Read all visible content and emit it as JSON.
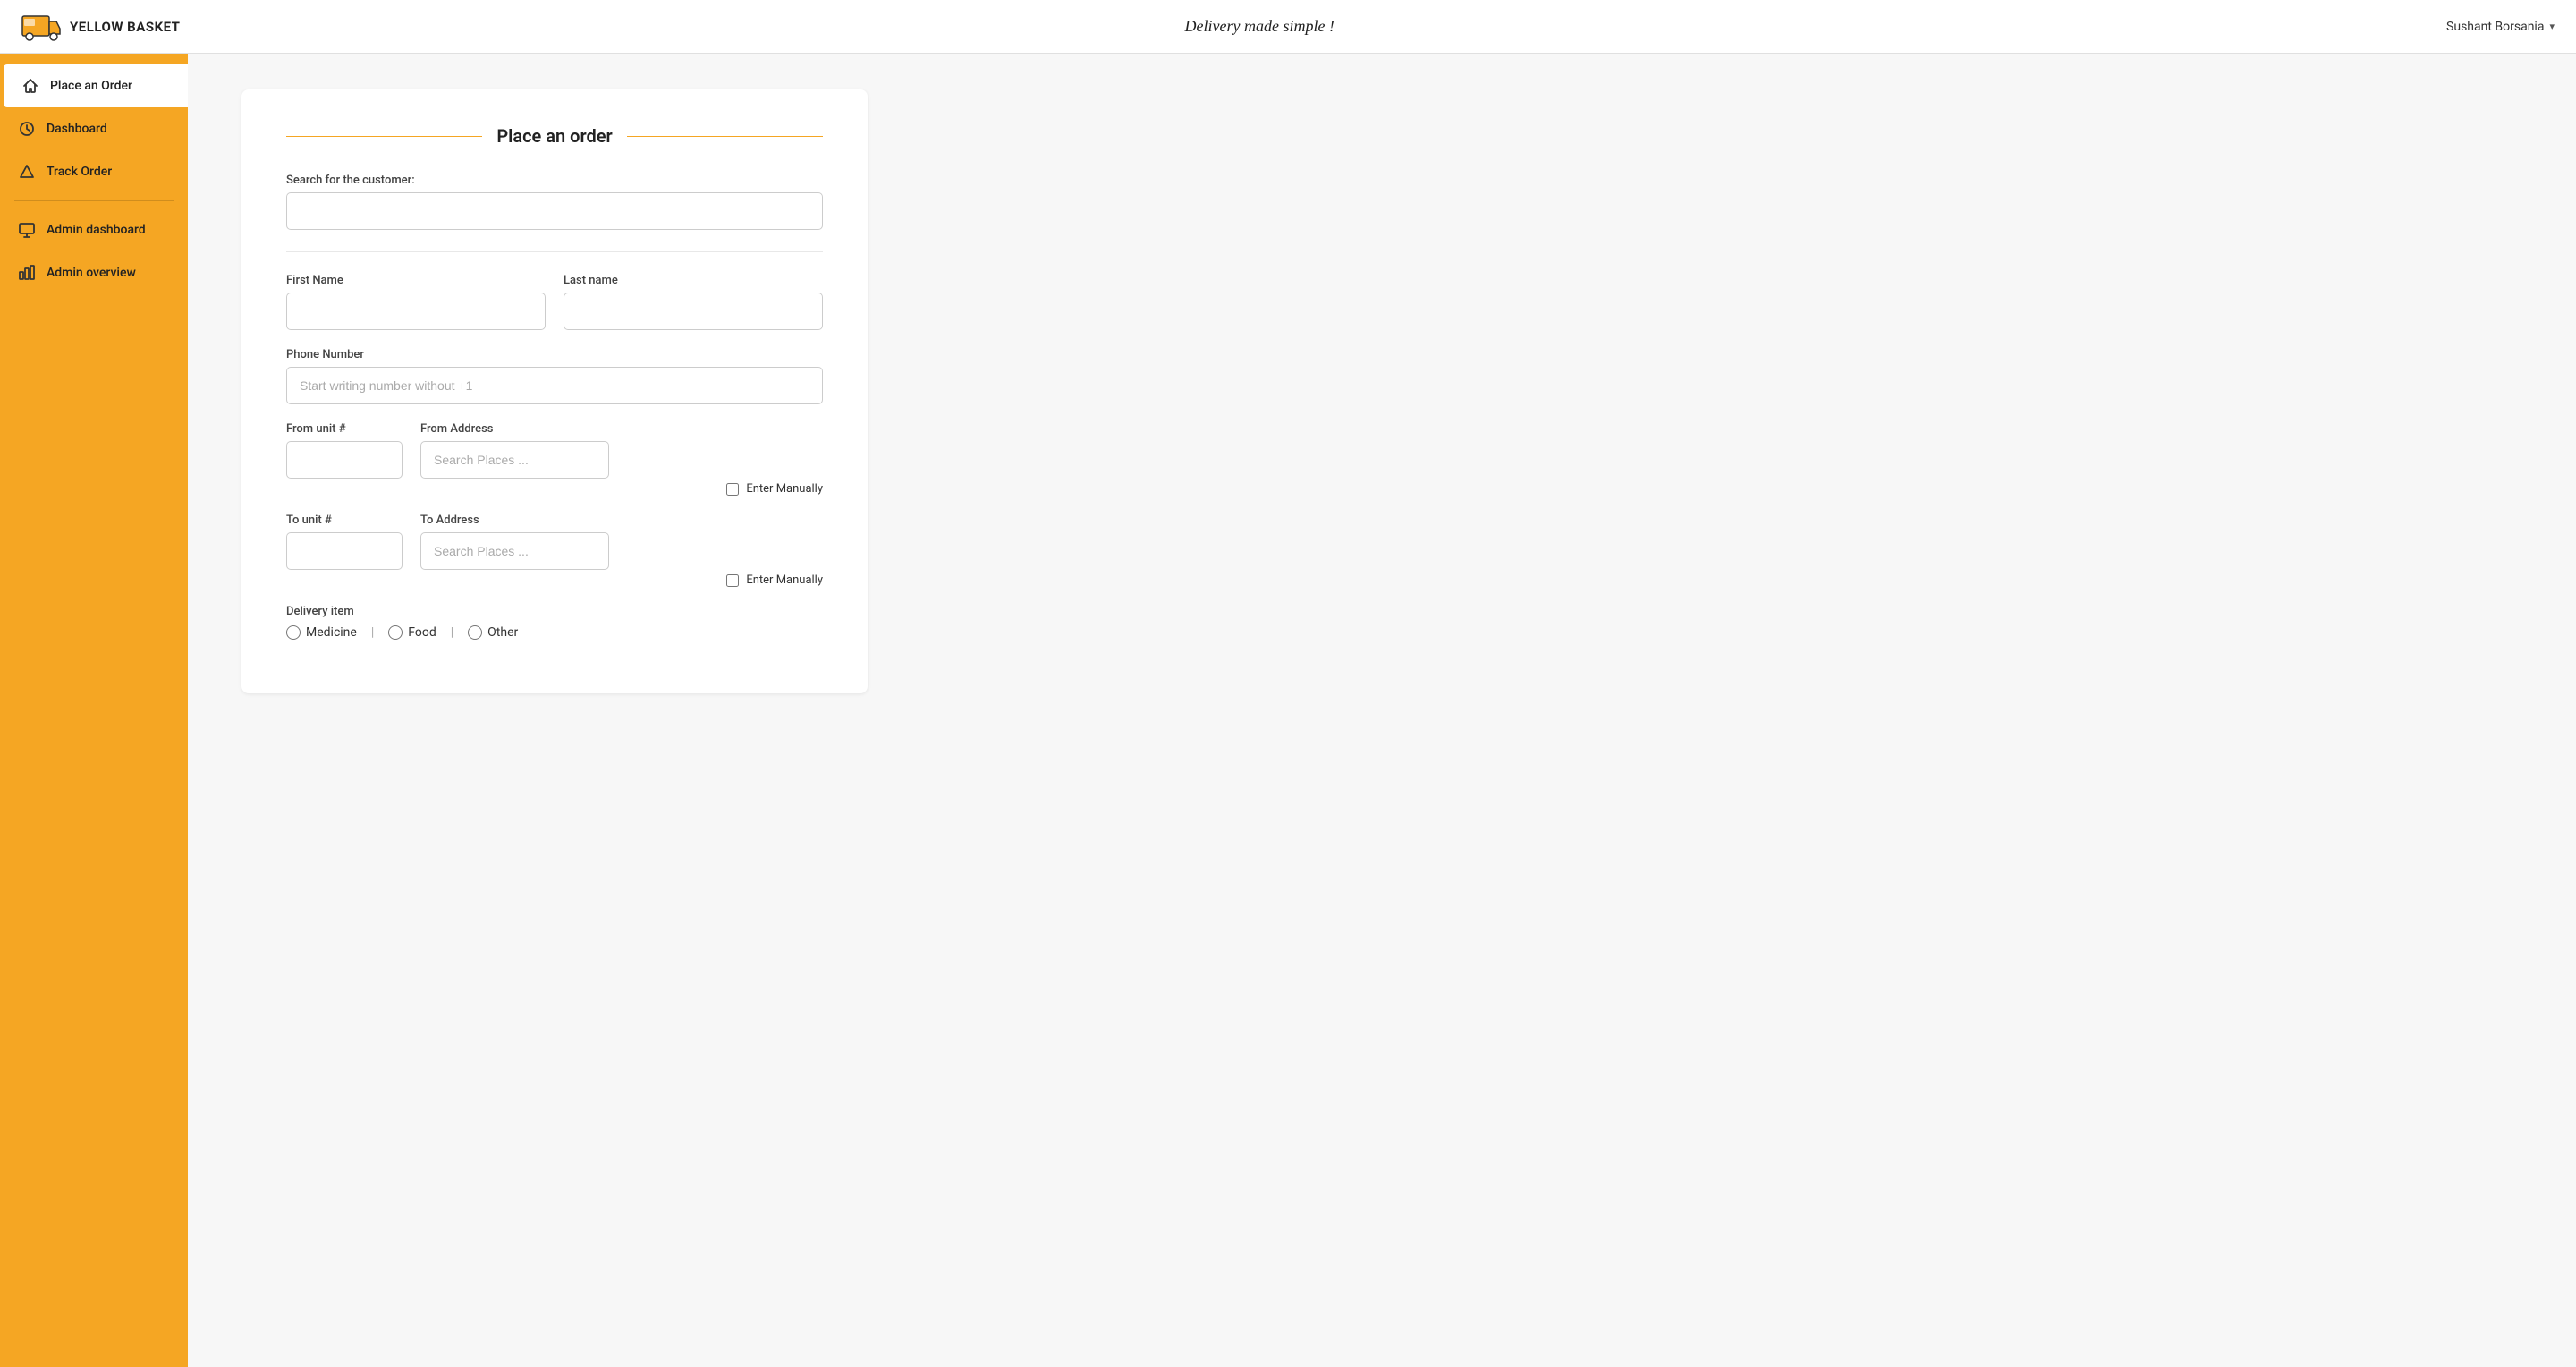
{
  "header": {
    "logo_text": "YELLOW BASKET",
    "tagline": "Delivery made simple !",
    "user_name": "Sushant Borsania",
    "chevron": "▾"
  },
  "sidebar": {
    "items": [
      {
        "id": "place-order",
        "label": "Place an Order",
        "active": true,
        "icon": "home"
      },
      {
        "id": "dashboard",
        "label": "Dashboard",
        "active": false,
        "icon": "clock"
      },
      {
        "id": "track-order",
        "label": "Track Order",
        "active": false,
        "icon": "triangle"
      }
    ],
    "admin_items": [
      {
        "id": "admin-dashboard",
        "label": "Admin dashboard",
        "active": false,
        "icon": "monitor"
      },
      {
        "id": "admin-overview",
        "label": "Admin overview",
        "active": false,
        "icon": "bar-chart"
      }
    ]
  },
  "form": {
    "title": "Place an order",
    "customer_search_label": "Search for the customer:",
    "customer_search_placeholder": "",
    "first_name_label": "First Name",
    "first_name_placeholder": "",
    "last_name_label": "Last name",
    "last_name_placeholder": "",
    "phone_label": "Phone Number",
    "phone_placeholder": "Start writing number without +1",
    "from_unit_label": "From unit #",
    "from_unit_placeholder": "",
    "from_address_label": "From Address",
    "from_address_placeholder": "Search Places ...",
    "enter_manually_from_label": "Enter Manually",
    "to_unit_label": "To unit #",
    "to_unit_placeholder": "",
    "to_address_label": "To Address",
    "to_address_placeholder": "Search Places ...",
    "enter_manually_to_label": "Enter Manually",
    "delivery_item_label": "Delivery item",
    "delivery_options": [
      {
        "id": "medicine",
        "label": "Medicine"
      },
      {
        "id": "food",
        "label": "Food"
      },
      {
        "id": "other",
        "label": "Other"
      }
    ]
  }
}
